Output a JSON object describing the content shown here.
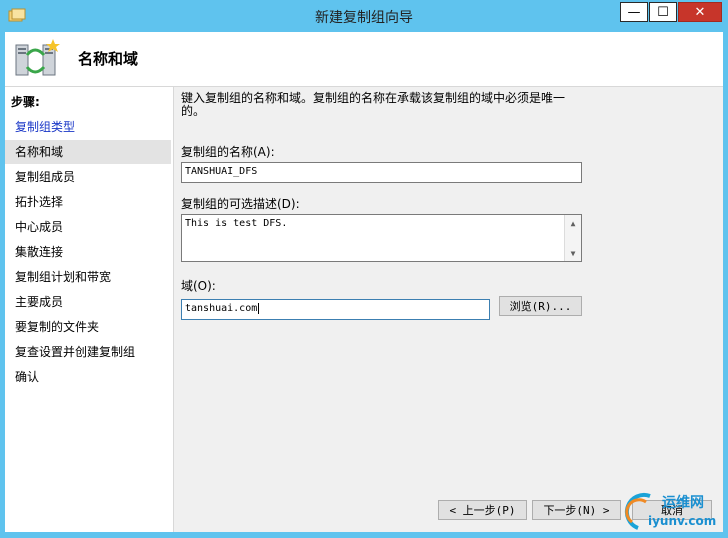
{
  "window": {
    "title": "新建复制组向导",
    "minimize_glyph": "—",
    "maximize_glyph": "☐",
    "close_glyph": "✕"
  },
  "header": {
    "title": "名称和域",
    "icon": "replication-group-icon"
  },
  "steps": {
    "heading": "步骤:",
    "items": [
      {
        "label": "复制组类型",
        "state": "active"
      },
      {
        "label": "名称和域",
        "state": "current"
      },
      {
        "label": "复制组成员",
        "state": "normal"
      },
      {
        "label": "拓扑选择",
        "state": "normal"
      },
      {
        "label": "中心成员",
        "state": "normal"
      },
      {
        "label": "集散连接",
        "state": "normal"
      },
      {
        "label": "复制组计划和带宽",
        "state": "normal"
      },
      {
        "label": "主要成员",
        "state": "normal"
      },
      {
        "label": "要复制的文件夹",
        "state": "normal"
      },
      {
        "label": "复查设置并创建复制组",
        "state": "normal"
      },
      {
        "label": "确认",
        "state": "normal"
      }
    ]
  },
  "form": {
    "description_line1": "键入复制组的名称和域。复制组的名称在承载该复制组的域中必须是唯一",
    "description_line2": "的。",
    "name_label": "复制组的名称(A):",
    "name_value": "TANSHUAI_DFS",
    "desc_label": "复制组的可选描述(D):",
    "desc_value": "This is test DFS.",
    "domain_label": "域(O):",
    "domain_value": "tanshuai.com",
    "browse_label": "浏览(R)..."
  },
  "buttons": {
    "prev": "< 上一步(P)",
    "next": "下一步(N) >",
    "cancel": "取消"
  },
  "watermark": {
    "line1": "运维网",
    "line2": "iyunv.com"
  },
  "colors": {
    "titlebar": "#5fc3ee",
    "close_button": "#c7352a",
    "active_step": "#1a37c7",
    "current_step_bg": "#e3e3e3"
  }
}
